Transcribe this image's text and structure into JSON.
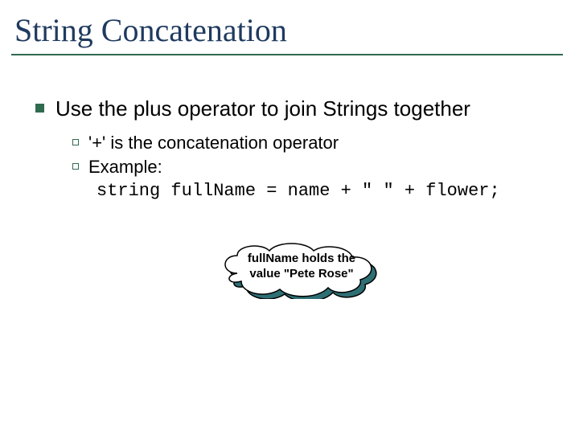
{
  "title": "String Concatenation",
  "main": {
    "point": "Use the plus operator to join Strings together",
    "sub1": "'+' is the concatenation operator",
    "sub2": "Example:",
    "code": "string fullName = name + \" \" + flower;"
  },
  "callout": {
    "line1": "fullName holds the",
    "line2": "value \"Pete Rose\""
  }
}
